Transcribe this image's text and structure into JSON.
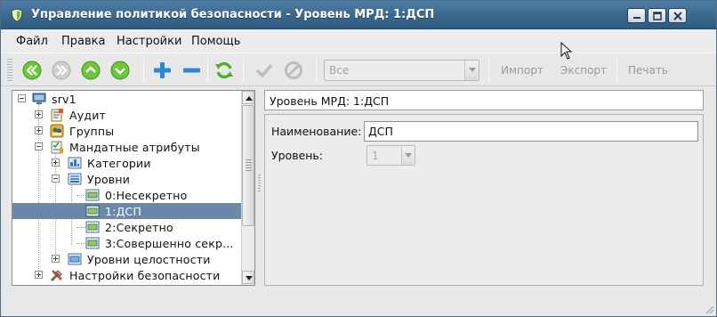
{
  "window": {
    "title": "Управление политикой безопасности - Уровень МРД: 1:ДСП",
    "app_icon": "shield-icon",
    "controls": [
      "minimize-icon",
      "maximize-icon",
      "close-icon"
    ]
  },
  "menu": {
    "items": [
      "Файл",
      "Правка",
      "Настройки",
      "Помощь"
    ]
  },
  "toolbar": {
    "buttons": [
      {
        "name": "first-button",
        "icon": "double-left-arrow-icon",
        "enabled": true
      },
      {
        "name": "last-button",
        "icon": "double-right-arrow-icon",
        "enabled": false
      },
      {
        "name": "up-button",
        "icon": "up-arrow-icon",
        "enabled": true
      },
      {
        "name": "down-button",
        "icon": "down-arrow-icon",
        "enabled": true
      },
      {
        "name": "add-button",
        "icon": "plus-icon",
        "enabled": true
      },
      {
        "name": "remove-button",
        "icon": "minus-icon",
        "enabled": true
      },
      {
        "name": "refresh-button",
        "icon": "refresh-icon",
        "enabled": true
      },
      {
        "name": "apply-button",
        "icon": "checkmark-icon",
        "enabled": false
      },
      {
        "name": "cancel-button",
        "icon": "cancel-icon",
        "enabled": false
      }
    ],
    "filter_value": "Все",
    "import_label": "Импорт",
    "export_label": "Экспорт",
    "print_label": "Печать"
  },
  "tree": {
    "items": [
      {
        "label": "srv1",
        "level": 0,
        "icon": "computer-icon",
        "expanded": true
      },
      {
        "label": "Аудит",
        "level": 1,
        "icon": "audit-icon",
        "expanded": false
      },
      {
        "label": "Группы",
        "level": 1,
        "icon": "groups-icon",
        "expanded": false
      },
      {
        "label": "Мандатные атрибуты",
        "level": 1,
        "icon": "mandatory-attributes-icon",
        "expanded": true
      },
      {
        "label": "Категории",
        "level": 2,
        "icon": "categories-icon",
        "expanded": false
      },
      {
        "label": "Уровни",
        "level": 2,
        "icon": "levels-icon",
        "expanded": true
      },
      {
        "label": "0:Несекретно",
        "level": 3,
        "icon": "level-item-icon"
      },
      {
        "label": "1:ДСП",
        "level": 3,
        "icon": "level-item-icon",
        "selected": true
      },
      {
        "label": "2:Секретно",
        "level": 3,
        "icon": "level-item-icon"
      },
      {
        "label": "3:Совершенно секр...",
        "level": 3,
        "icon": "level-item-icon"
      },
      {
        "label": "Уровни целостности",
        "level": 2,
        "icon": "integrity-levels-icon",
        "expanded": false
      },
      {
        "label": "Настройки безопасности",
        "level": 1,
        "icon": "security-settings-icon",
        "expanded": false
      }
    ]
  },
  "details": {
    "header": "Уровень МРД: 1:ДСП",
    "name_label": "Наименование:",
    "name_value": "ДСП",
    "level_label": "Уровень:",
    "level_value": "1"
  },
  "colors": {
    "titlebar": "#3e6b91",
    "selection": "#6b88a8",
    "toolbar_green": "#5cb833",
    "toolbar_blue": "#2b86d6"
  }
}
